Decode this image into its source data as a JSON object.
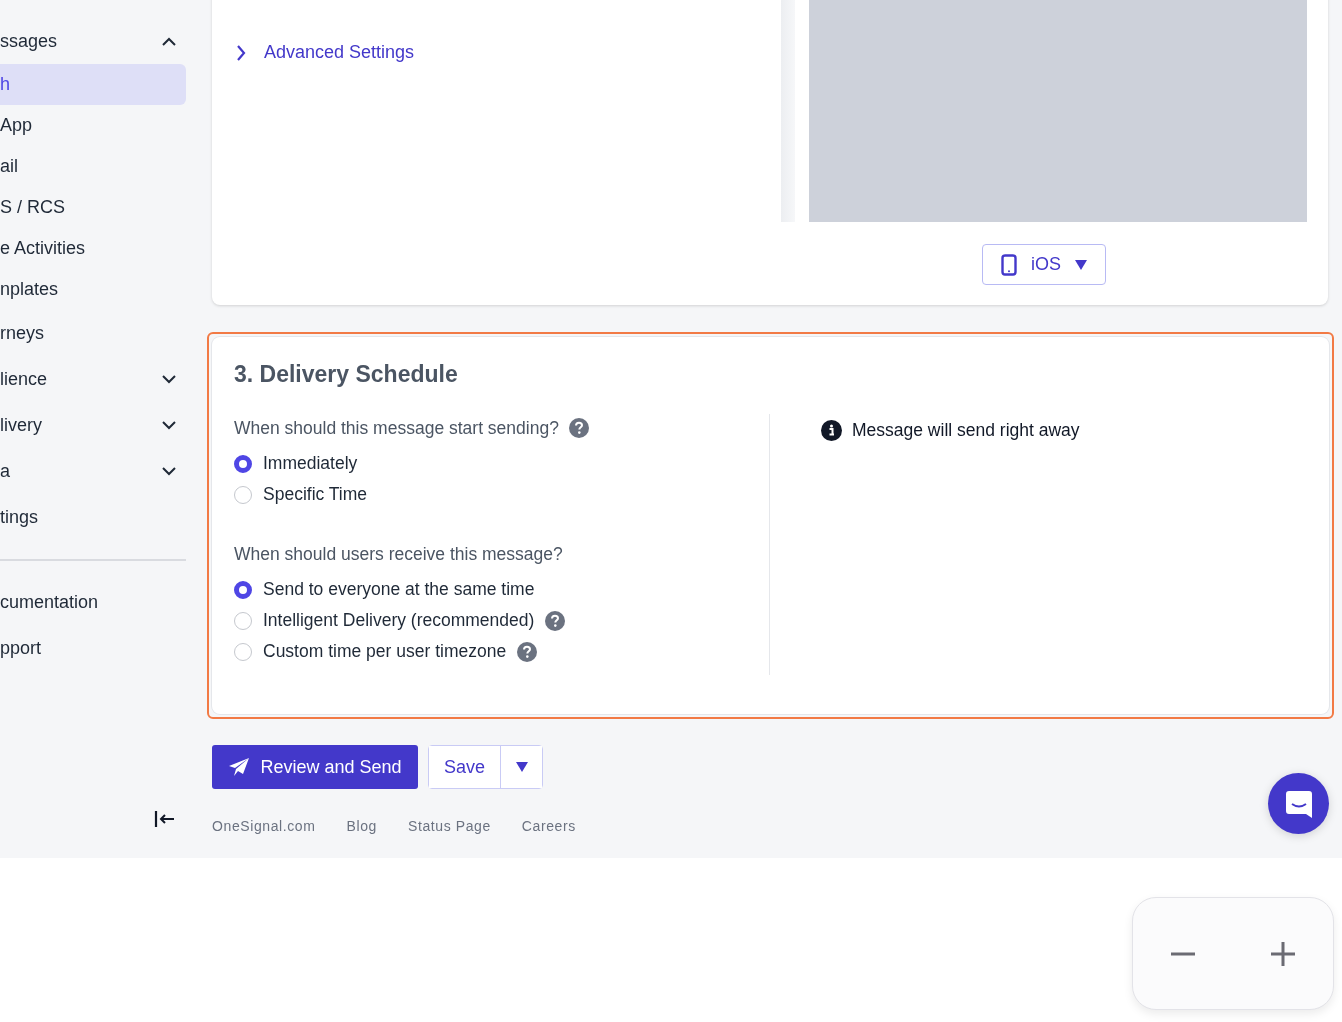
{
  "sidebar": {
    "items": [
      {
        "label": "ssages",
        "kind": "group",
        "expanded": true,
        "children": [
          {
            "label": "h",
            "selected": true
          },
          {
            "label": "App",
            "selected": false
          },
          {
            "label": "ail",
            "selected": false
          },
          {
            "label": "S / RCS",
            "selected": false
          },
          {
            "label": "e Activities",
            "selected": false
          },
          {
            "label": "nplates",
            "selected": false
          }
        ]
      },
      {
        "label": "rneys",
        "kind": "link"
      },
      {
        "label": "lience",
        "kind": "group",
        "expanded": false
      },
      {
        "label": "livery",
        "kind": "group",
        "expanded": false
      },
      {
        "label": "a",
        "kind": "group",
        "expanded": false
      },
      {
        "label": "tings",
        "kind": "link"
      }
    ],
    "secondary": [
      "cumentation",
      "pport"
    ]
  },
  "settings_card": {
    "sections": [
      {
        "label": "Advanced Settings",
        "expanded": false
      }
    ],
    "preview": {
      "platform_button": "iOS"
    }
  },
  "delivery_schedule": {
    "title": "3. Delivery Schedule",
    "highlighted": true,
    "questions": [
      {
        "label": "When should this message start sending?",
        "help": true,
        "options": [
          {
            "label": "Immediately",
            "selected": true,
            "help": false
          },
          {
            "label": "Specific Time",
            "selected": false,
            "help": false
          }
        ]
      },
      {
        "label": "When should users receive this message?",
        "help": false,
        "options": [
          {
            "label": "Send to everyone at the same time",
            "selected": true,
            "help": false
          },
          {
            "label": "Intelligent Delivery (recommended)",
            "selected": false,
            "help": true
          },
          {
            "label": "Custom time per user timezone",
            "selected": false,
            "help": true
          }
        ]
      }
    ],
    "info": "Message will send right away"
  },
  "actions": {
    "primary": "Review and Send",
    "secondary": "Save"
  },
  "footer_links": [
    "OneSignal.com",
    "Blog",
    "Status Page",
    "Careers"
  ]
}
